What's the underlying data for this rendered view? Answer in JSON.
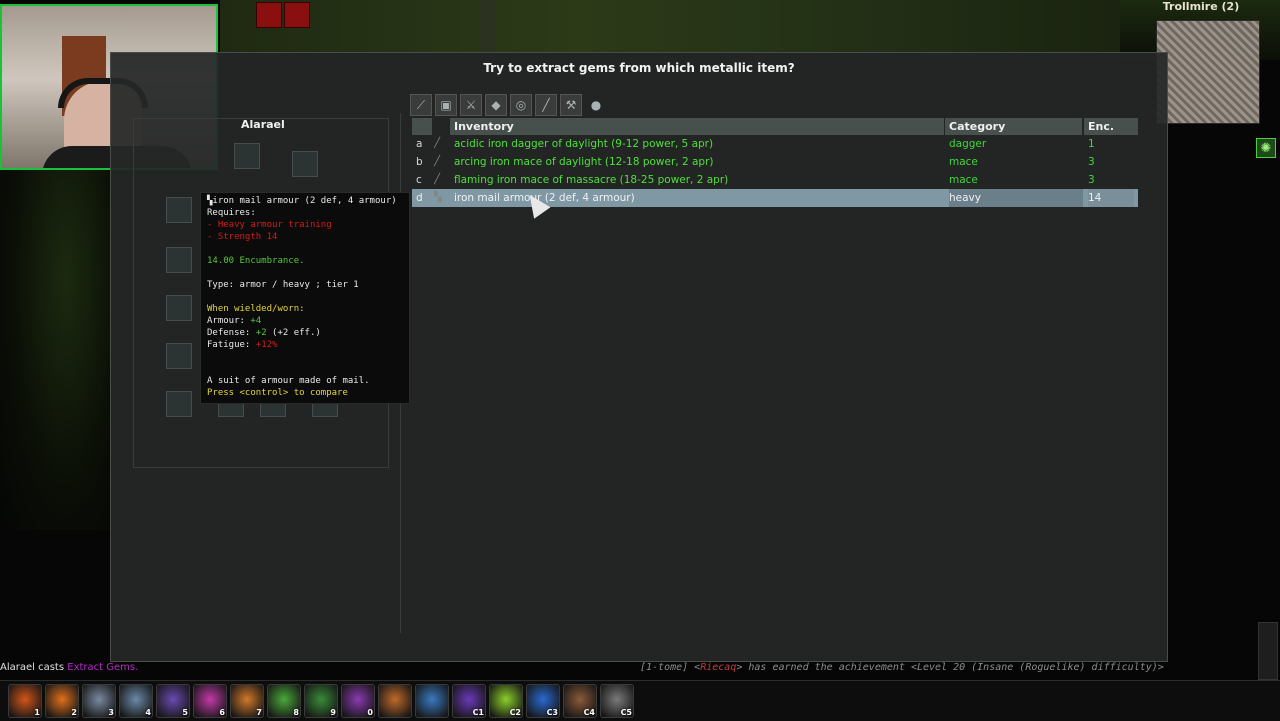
{
  "dialog": {
    "title": "Try to extract gems from which metallic item?"
  },
  "character": {
    "name": "Alarael"
  },
  "minimap": {
    "location": "Trollmire (2)"
  },
  "filters": [
    {
      "icon": "all-items-icon"
    },
    {
      "icon": "armor-icon"
    },
    {
      "icon": "weapon-icon"
    },
    {
      "icon": "gem-icon"
    },
    {
      "icon": "ring-icon"
    },
    {
      "icon": "wand-icon"
    },
    {
      "icon": "tool-icon"
    },
    {
      "icon": "misc-icon"
    }
  ],
  "inventory": {
    "headers": {
      "name": "Inventory",
      "category": "Category",
      "enc": "Enc."
    },
    "rows": [
      {
        "letter": "a",
        "name": "acidic iron dagger of daylight (9-12 power, 5 apr)",
        "category": "dagger",
        "enc": "1",
        "selected": false
      },
      {
        "letter": "b",
        "name": "arcing iron mace of daylight (12-18 power, 2 apr)",
        "category": "mace",
        "enc": "3",
        "selected": false
      },
      {
        "letter": "c",
        "name": "flaming iron mace of massacre (18-25 power, 2 apr)",
        "category": "mace",
        "enc": "3",
        "selected": false
      },
      {
        "letter": "d",
        "name": "iron mail armour (2 def, 4 armour)",
        "category": "heavy",
        "enc": "14",
        "selected": true
      }
    ]
  },
  "tooltip": {
    "title": "iron mail armour (2 def, 4 armour)",
    "requires": "Requires:",
    "req1": "- Heavy armour training",
    "req2": "- Strength 14",
    "encumbrance": "14.00 Encumbrance.",
    "type": "Type: armor / heavy ; tier 1",
    "worn": "When wielded/worn:",
    "armour_label": "Armour: ",
    "armour_val": "+4",
    "defense_label": "Defense: ",
    "defense_val": "+2",
    "defense_eff": " (+2 eff.)",
    "fatigue_label": "Fatigue: ",
    "fatigue_val": "+12%",
    "desc": "A suit of armour made of mail.",
    "compare": "Press <control> to compare"
  },
  "log": {
    "left_prefix": "Alarael casts ",
    "left_spell": "Extract Gems.",
    "right_channel": "[1-tome] <",
    "right_user": "Riecaq",
    "right_text": "> has earned the achievement <Level 20 (Insane (Roguelike) difficulty)>"
  },
  "hotbar": [
    {
      "label": "1",
      "color": "#d2551a"
    },
    {
      "label": "2",
      "color": "#e0701c"
    },
    {
      "label": "3",
      "color": "#7a8aa0"
    },
    {
      "label": "4",
      "color": "#6a8aa8"
    },
    {
      "label": "5",
      "color": "#6a4ab0"
    },
    {
      "label": "6",
      "color": "#c23aa8"
    },
    {
      "label": "7",
      "color": "#d0782a"
    },
    {
      "label": "8",
      "color": "#4aa83a"
    },
    {
      "label": "9",
      "color": "#3a8a3a"
    },
    {
      "label": "0",
      "color": "#8a3ab0"
    },
    {
      "label": "",
      "color": "#c06a2a"
    },
    {
      "label": "",
      "color": "#3a7ac0"
    },
    {
      "label": "C1",
      "color": "#6a3ab8"
    },
    {
      "label": "C2",
      "color": "#8ad02a"
    },
    {
      "label": "C3",
      "color": "#2a6ad0"
    },
    {
      "label": "C4",
      "color": "#8a5a3a"
    },
    {
      "label": "C5",
      "color": "#7a7a7a"
    }
  ]
}
